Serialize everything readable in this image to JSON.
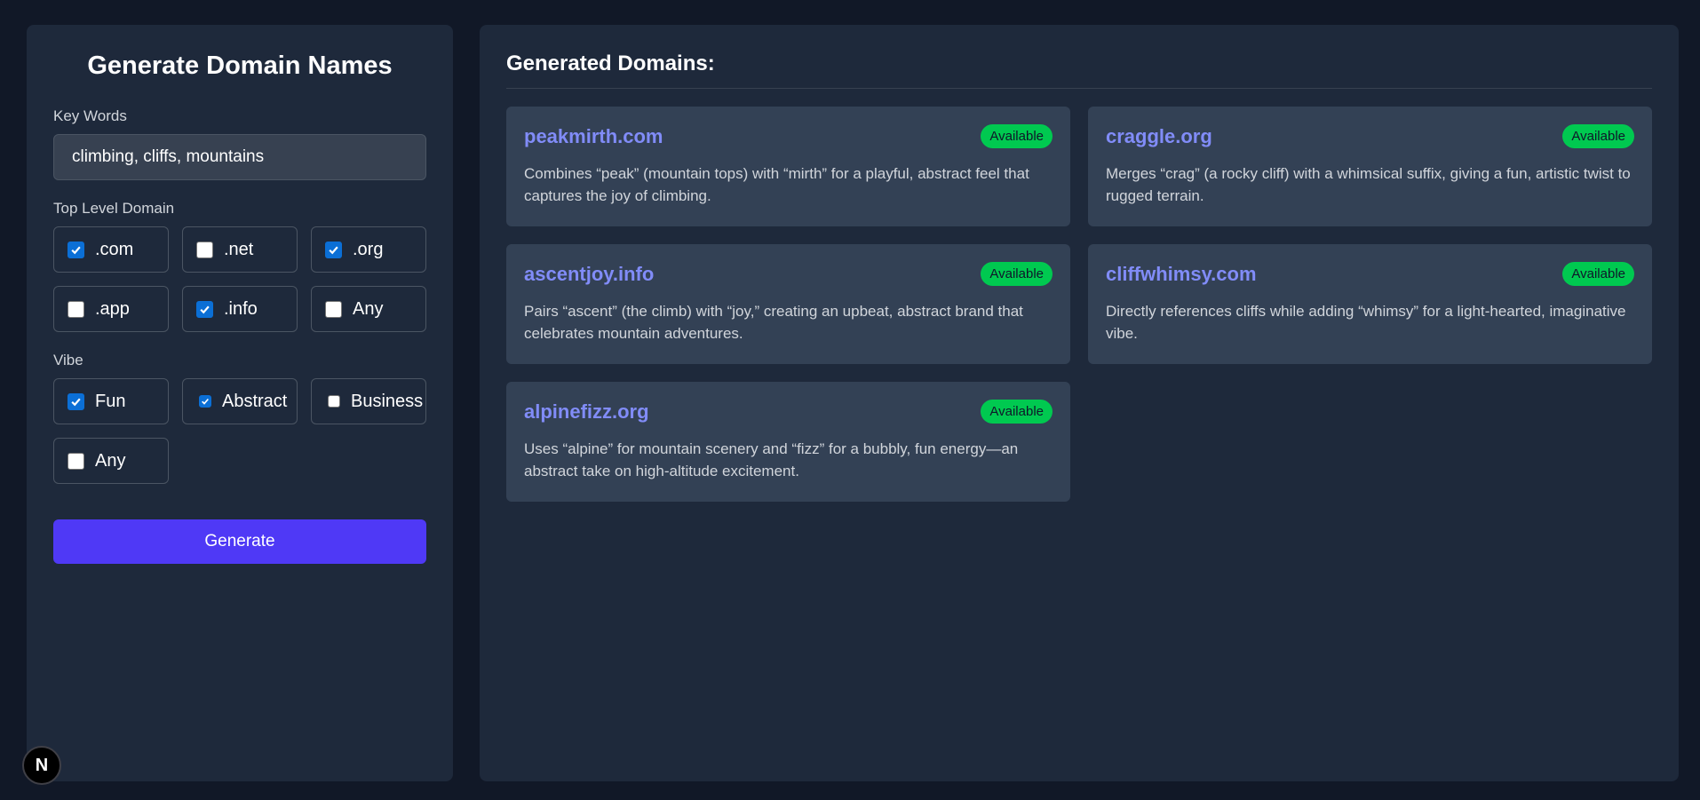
{
  "form": {
    "title": "Generate Domain Names",
    "keywords_label": "Key Words",
    "keywords_value": "climbing, cliffs, mountains",
    "tld_label": "Top Level Domain",
    "tlds": [
      {
        "label": ".com",
        "checked": true
      },
      {
        "label": ".net",
        "checked": false
      },
      {
        "label": ".org",
        "checked": true
      },
      {
        "label": ".app",
        "checked": false
      },
      {
        "label": ".info",
        "checked": true
      },
      {
        "label": "Any",
        "checked": false
      }
    ],
    "vibe_label": "Vibe",
    "vibes": [
      {
        "label": "Fun",
        "checked": true
      },
      {
        "label": "Abstract",
        "checked": true
      },
      {
        "label": "Business",
        "checked": false
      },
      {
        "label": "Any",
        "checked": false
      }
    ],
    "generate_label": "Generate"
  },
  "results": {
    "title": "Generated Domains:",
    "domains": [
      {
        "name": "peakmirth.com",
        "status": "Available",
        "description": "Combines “peak” (mountain tops) with “mirth” for a playful, abstract feel that captures the joy of climbing."
      },
      {
        "name": "craggle.org",
        "status": "Available",
        "description": "Merges “crag” (a rocky cliff) with a whimsical suffix, giving a fun, artistic twist to rugged terrain."
      },
      {
        "name": "ascentjoy.info",
        "status": "Available",
        "description": "Pairs “ascent” (the climb) with “joy,” creating an upbeat, abstract brand that celebrates mountain adventures."
      },
      {
        "name": "cliffwhimsy.com",
        "status": "Available",
        "description": "Directly references cliffs while adding “whimsy” for a light-hearted, imaginative vibe."
      },
      {
        "name": "alpinefizz.org",
        "status": "Available",
        "description": "Uses “alpine” for mountain scenery and “fizz” for a bubbly, fun energy—an abstract take on high-altitude excitement."
      }
    ]
  },
  "dev_badge": {
    "label": "N"
  },
  "colors": {
    "accent": "#4f39f6",
    "domain_link": "#818cf8",
    "available": "#00c950",
    "checkbox": "#0b6fd6"
  }
}
